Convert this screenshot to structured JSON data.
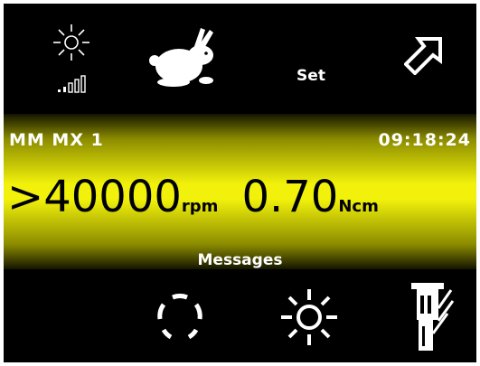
{
  "top_bar": {
    "brightness_icon": "brightness-signal-icon",
    "speed_icon": "rabbit-icon",
    "set_label": "Set",
    "expand_icon": "arrow-up-right-icon"
  },
  "status": {
    "device_name": "MM MX 1",
    "time": "09:18:24",
    "speed_value": ">40000",
    "speed_unit": "rpm",
    "torque_value": "0.70",
    "torque_unit": "Ncm",
    "messages_label": "Messages"
  },
  "bottom_bar": {
    "rotate_icon": "rotation-direction-icon",
    "light_icon": "light-icon",
    "handpiece_icon": "handpiece-icon"
  },
  "colors": {
    "background": "#000000",
    "band": "#f1f10b",
    "text_light": "#ffffff"
  }
}
